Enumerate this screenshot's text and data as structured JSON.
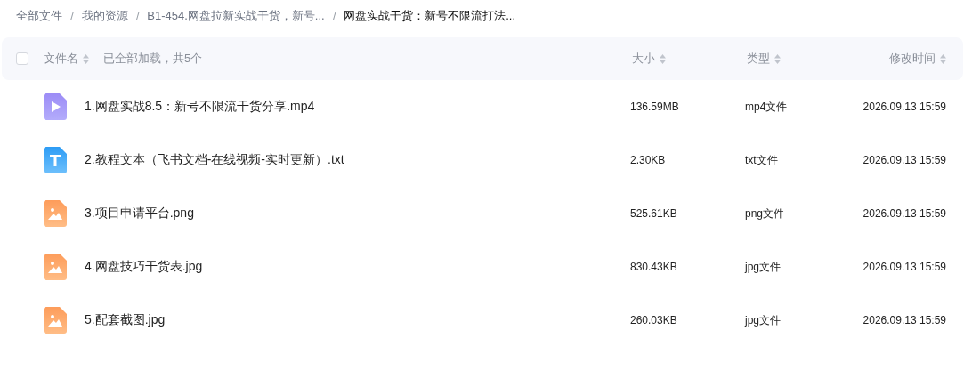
{
  "breadcrumb_separator": "/",
  "breadcrumb": [
    {
      "label": "全部文件",
      "selected": false
    },
    {
      "label": "我的资源",
      "selected": false
    },
    {
      "label": "B1-454.网盘拉新实战干货，新号...",
      "selected": false
    },
    {
      "label": "网盘实战干货：新号不限流打法...",
      "selected": true
    }
  ],
  "table": {
    "select_all": {
      "checked": false
    },
    "status": "已全部加载，共5个",
    "columns": [
      "文件名",
      "大小",
      "类型",
      "修改时间"
    ],
    "rows": [
      {
        "kind": "video",
        "name": "1.网盘实战8.5：新号不限流干货分享.mp4",
        "size": "136.59MB",
        "type": "mp4文件",
        "modified": "2026.09.13 15:59"
      },
      {
        "kind": "text",
        "name": "2.教程文本（飞书文档-在线视频-实时更新）.txt",
        "size": "2.30KB",
        "type": "txt文件",
        "modified": "2026.09.13 15:59"
      },
      {
        "kind": "image",
        "name": "3.项目申请平台.png",
        "size": "525.61KB",
        "type": "png文件",
        "modified": "2026.09.13 15:59"
      },
      {
        "kind": "image",
        "name": "4.网盘技巧干货表.jpg",
        "size": "830.43KB",
        "type": "jpg文件",
        "modified": "2026.09.13 15:59"
      },
      {
        "kind": "image",
        "name": "5.配套截图.jpg",
        "size": "260.03KB",
        "type": "jpg文件",
        "modified": "2026.09.13 15:59"
      }
    ]
  }
}
